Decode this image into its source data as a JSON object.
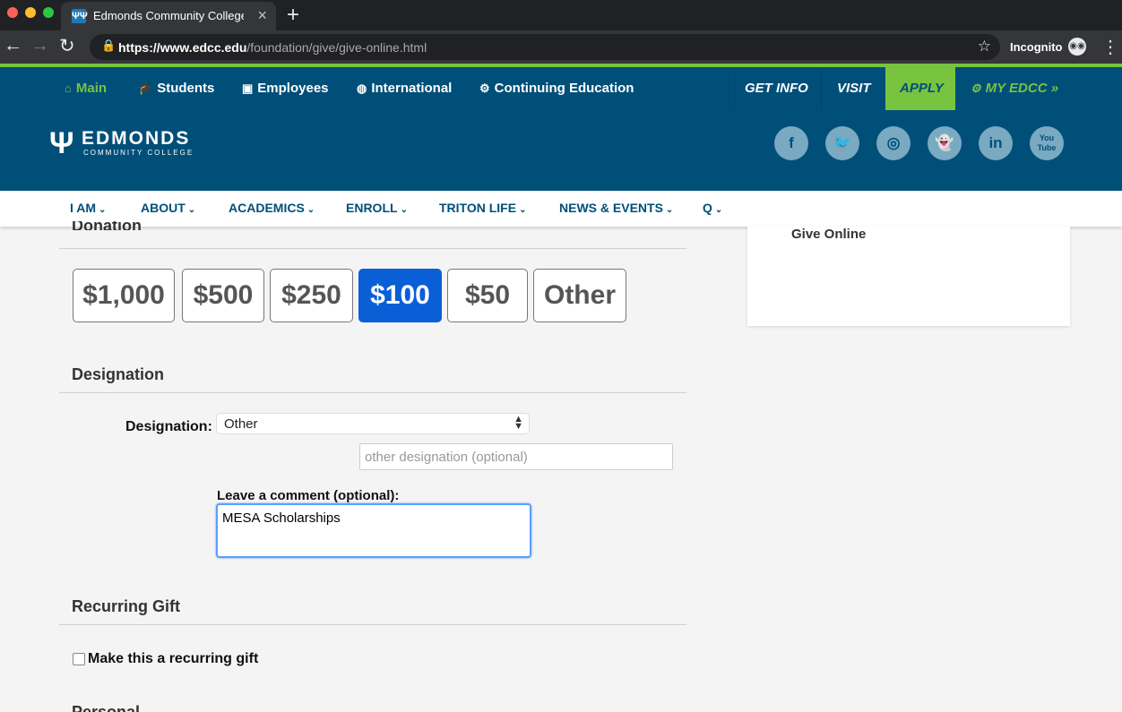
{
  "browser": {
    "tab_title": "Edmonds Community College:",
    "tab_icon": "ΨΨ",
    "url_host": "https://www.edcc.edu",
    "url_path": "/foundation/give/give-online.html",
    "incognito": "Incognito",
    "colors": {
      "red": "#ff5f57",
      "yellow": "#febc2e",
      "green": "#28c840",
      "chrome_bg": "#202124"
    }
  },
  "utility_nav": [
    {
      "label": "Main",
      "icon": "home-icon"
    },
    {
      "label": "Students",
      "icon": "graduation-cap-icon"
    },
    {
      "label": "Employees",
      "icon": "briefcase-icon"
    },
    {
      "label": "International",
      "icon": "globe-icon"
    },
    {
      "label": "Continuing Education",
      "icon": "gears-icon"
    }
  ],
  "right_nav": [
    "GET INFO",
    "VISIT",
    "APPLY",
    "MY EDCC"
  ],
  "brand": {
    "name": "EDMONDS",
    "subtitle": "COMMUNITY COLLEGE",
    "social": [
      "f",
      "🐦",
      "◎",
      "👻",
      "in",
      "You Tube"
    ]
  },
  "site_nav": [
    "I AM",
    "ABOUT",
    "ACADEMICS",
    "ENROLL",
    "TRITON LIFE",
    "NEWS & EVENTS",
    "Q"
  ],
  "donation": {
    "title": "Donation",
    "amounts": [
      "$1,000",
      "$500",
      "$250",
      "$100",
      "$50",
      "Other"
    ],
    "selected": "$100"
  },
  "designation": {
    "title": "Designation",
    "label": "Designation:",
    "selected": "Other",
    "placeholder": "other designation (optional)",
    "comment_label": "Leave a comment (optional):",
    "comment_value": "MESA Scholarships"
  },
  "recurring": {
    "title": "Recurring Gift",
    "checkbox_label": "Make this a recurring gift"
  },
  "sidebar": {
    "title": "Give Online"
  },
  "bottom": {
    "partial_title": "Personal Information"
  },
  "colors": {
    "brand_blue": "#004f79",
    "accent_green": "#78c33f",
    "selected_blue": "#0a5fd7"
  }
}
